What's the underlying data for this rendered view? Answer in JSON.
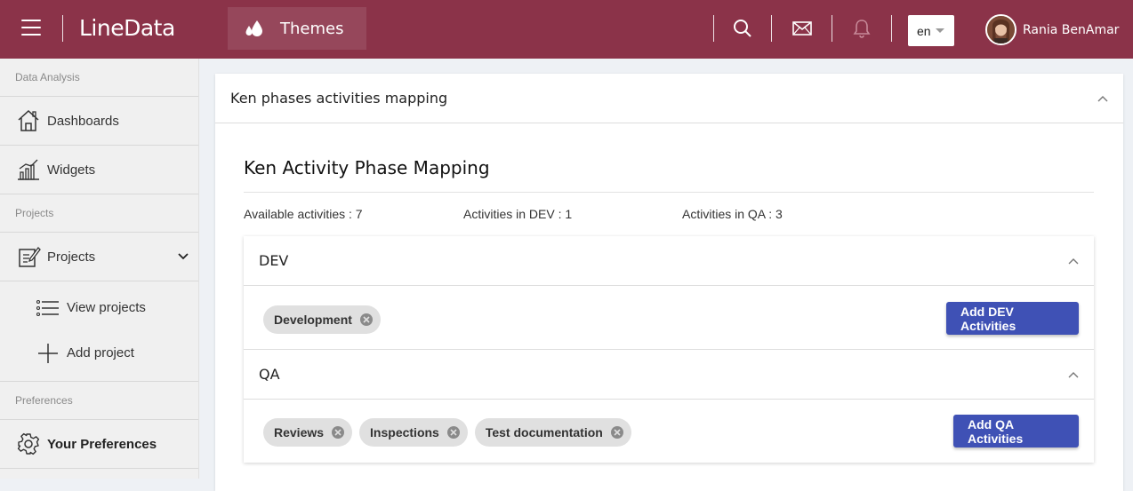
{
  "topbar": {
    "brand": "LineData",
    "themes_label": "Themes",
    "language": "en",
    "user_name": "Rania BenAmar"
  },
  "sidebar": {
    "section_data_analysis": "Data Analysis",
    "dashboards": "Dashboards",
    "widgets": "Widgets",
    "section_projects": "Projects",
    "projects": "Projects",
    "view_projects": "View projects",
    "add_project": "Add project",
    "section_preferences": "Preferences",
    "your_preferences": "Your Preferences"
  },
  "main": {
    "card_title": "Ken phases activities mapping",
    "inner_title": "Ken Activity Phase Mapping",
    "stats": {
      "available": "Available activities : 7",
      "in_dev": "Activities in DEV : 1",
      "in_qa": "Activities in QA : 3"
    },
    "phases": [
      {
        "name": "DEV",
        "chips": [
          "Development"
        ],
        "button": "Add DEV Activities"
      },
      {
        "name": "QA",
        "chips": [
          "Reviews",
          "Inspections",
          "Test documentation"
        ],
        "button": "Add QA Activities"
      }
    ]
  },
  "colors": {
    "topbar": "#8b3349",
    "primary_button": "#3f51b5",
    "chip": "#e0e0e0"
  }
}
